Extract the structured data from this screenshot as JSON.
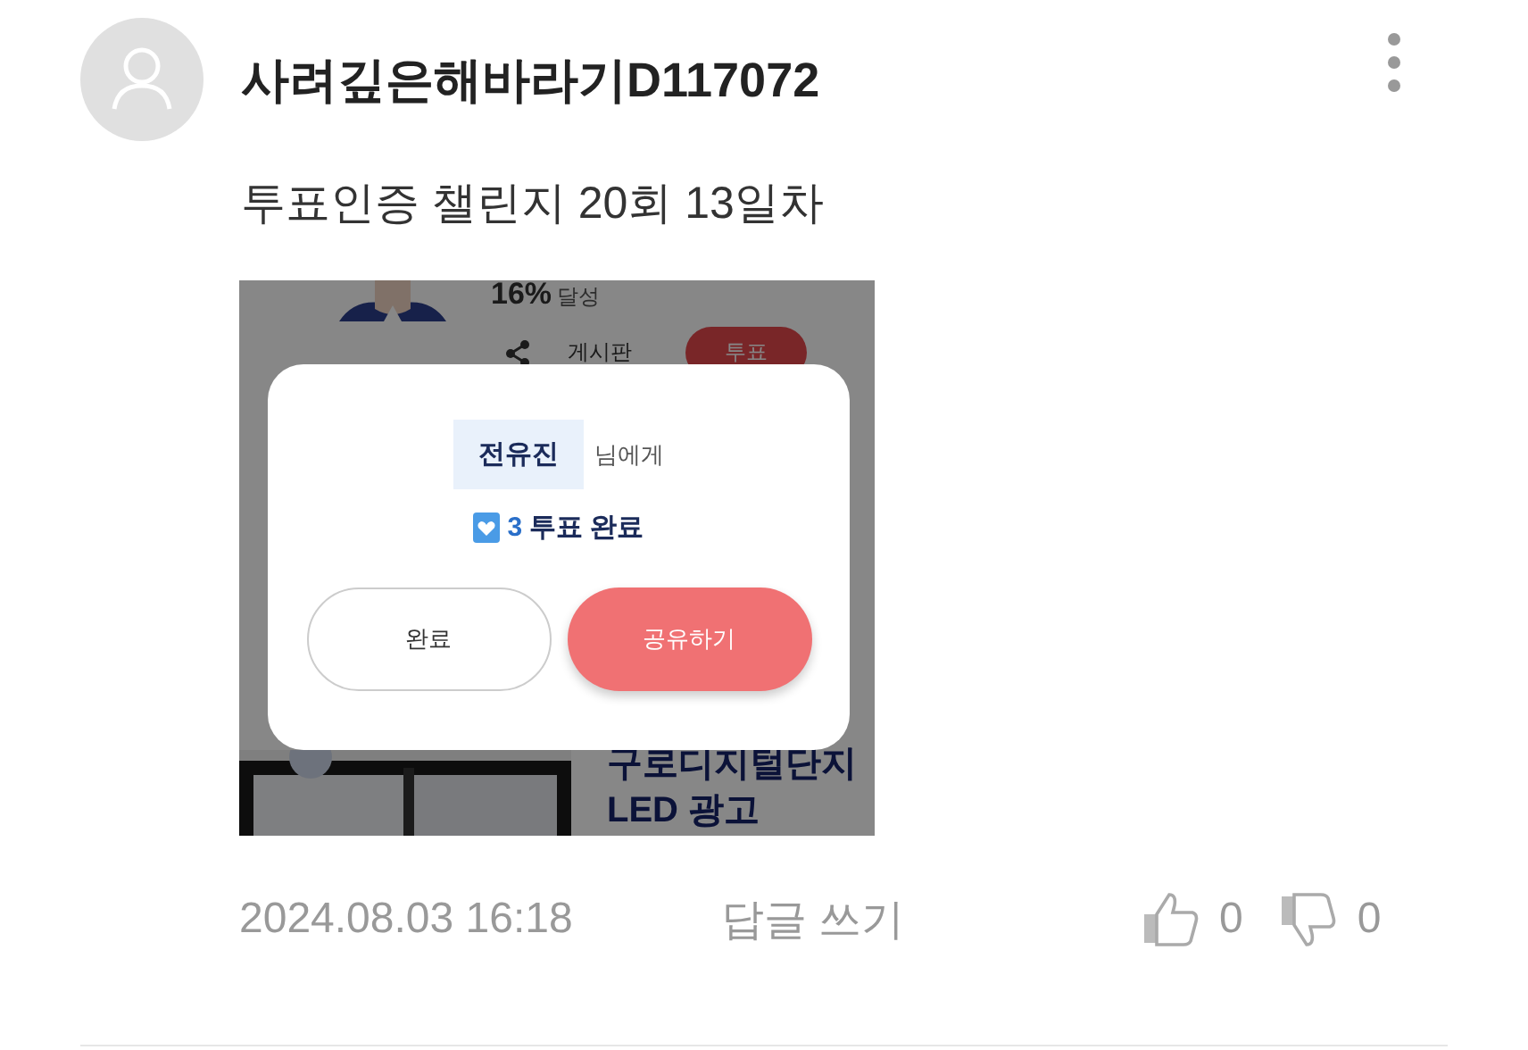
{
  "comment": {
    "author": "사려깊은해바라기D117072",
    "text": "투표인증 챌린지 20회 13일차",
    "date": "2024.08.03 16:18",
    "reply": "답글 쓰기",
    "likes": "0",
    "dislikes": "0"
  },
  "attachment": {
    "progress": "16%",
    "progress_label": "달성",
    "tabs": [
      {
        "label": "게시판",
        "selected": false
      },
      {
        "label": "투표",
        "selected": true
      }
    ],
    "banner": [
      "구로디지털단지",
      "LED 광고"
    ],
    "dialog": {
      "recipient": "전유진",
      "recipient_suffix": "님에게",
      "count": "3",
      "result": "투표 완료",
      "buttons": [
        {
          "label": "완료",
          "kind": "secondary"
        },
        {
          "label": "공유하기",
          "kind": "primary"
        }
      ]
    }
  }
}
